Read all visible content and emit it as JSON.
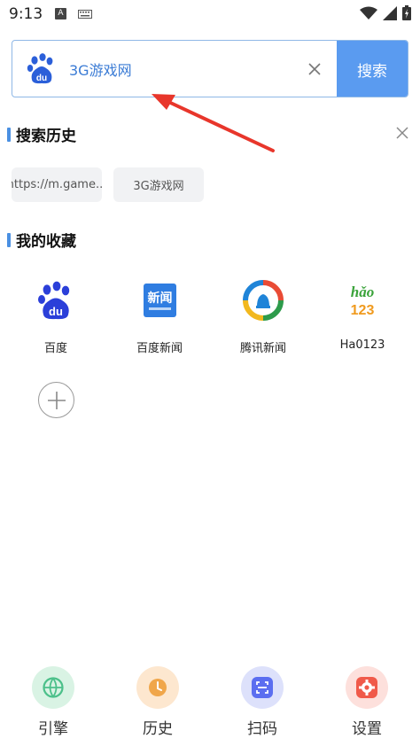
{
  "status_bar": {
    "time": "9:13",
    "notification_letter": "A",
    "icons": [
      "keyboard-icon",
      "wifi-icon",
      "signal-icon",
      "battery-icon"
    ]
  },
  "search": {
    "engine_icon": "baidu-paw-icon",
    "value": "3G游戏网",
    "button_label": "搜索",
    "accent_color": "#5a9bf0"
  },
  "history": {
    "title": "搜索历史",
    "items": [
      "https://m.game...",
      "3G游戏网"
    ]
  },
  "favorites": {
    "title": "我的收藏",
    "items": [
      {
        "label": "百度",
        "icon": "baidu-icon"
      },
      {
        "label": "百度新闻",
        "icon": "baidu-news-icon"
      },
      {
        "label": "腾讯新闻",
        "icon": "tencent-news-icon"
      },
      {
        "label": "Ha0123",
        "icon": "hao123-icon"
      }
    ],
    "add_icon": "plus-icon"
  },
  "bottom_nav": {
    "items": [
      {
        "label": "引擎",
        "icon": "engine-icon",
        "color": "#4cc08a"
      },
      {
        "label": "历史",
        "icon": "clock-icon",
        "color": "#f0a64a"
      },
      {
        "label": "扫码",
        "icon": "scan-icon",
        "color": "#5b6ef0"
      },
      {
        "label": "设置",
        "icon": "gear-icon",
        "color": "#f05a4a"
      }
    ]
  }
}
